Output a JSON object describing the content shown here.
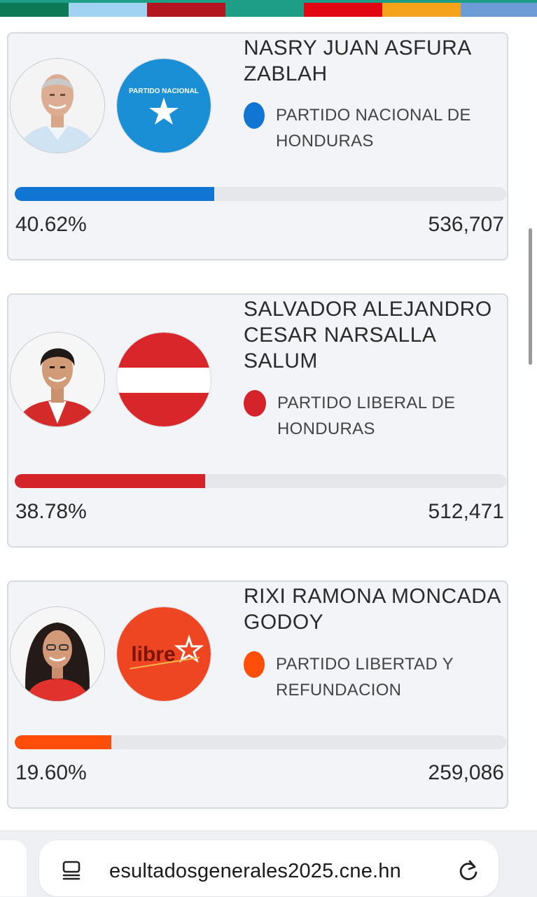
{
  "top_stripe_colors": [
    "#0e7a55",
    "#9fd3f1",
    "#b3161e",
    "#1e9e87",
    "#e30613",
    "#f5a31a",
    "#6d9bd6"
  ],
  "candidates": [
    {
      "name": "NASRY JUAN ASFURA ZABLAH",
      "party": "PARTIDO NACIONAL DE HONDURAS",
      "party_logo_text": "PARTIDO NACIONAL",
      "color": "#1175d4",
      "percent_text": "40.62%",
      "percent": 40.62,
      "votes": "536,707"
    },
    {
      "name": "SALVADOR ALEJANDRO CESAR NARSALLA SALUM",
      "party": "PARTIDO LIBERAL DE HONDURAS",
      "party_logo_text": "",
      "color": "#d42329",
      "percent_text": "38.78%",
      "percent": 38.78,
      "votes": "512,471"
    },
    {
      "name": "RIXI RAMONA MONCADA GODOY",
      "party": "PARTIDO LIBERTAD Y REFUNDACION",
      "party_logo_text": "libre",
      "color": "#ff4d0a",
      "percent_text": "19.60%",
      "percent": 19.6,
      "votes": "259,086"
    }
  ],
  "browser": {
    "url": "esultadosgenerales2025.cne.hn",
    "icons": [
      "reader-mode-icon",
      "reload-icon"
    ]
  }
}
